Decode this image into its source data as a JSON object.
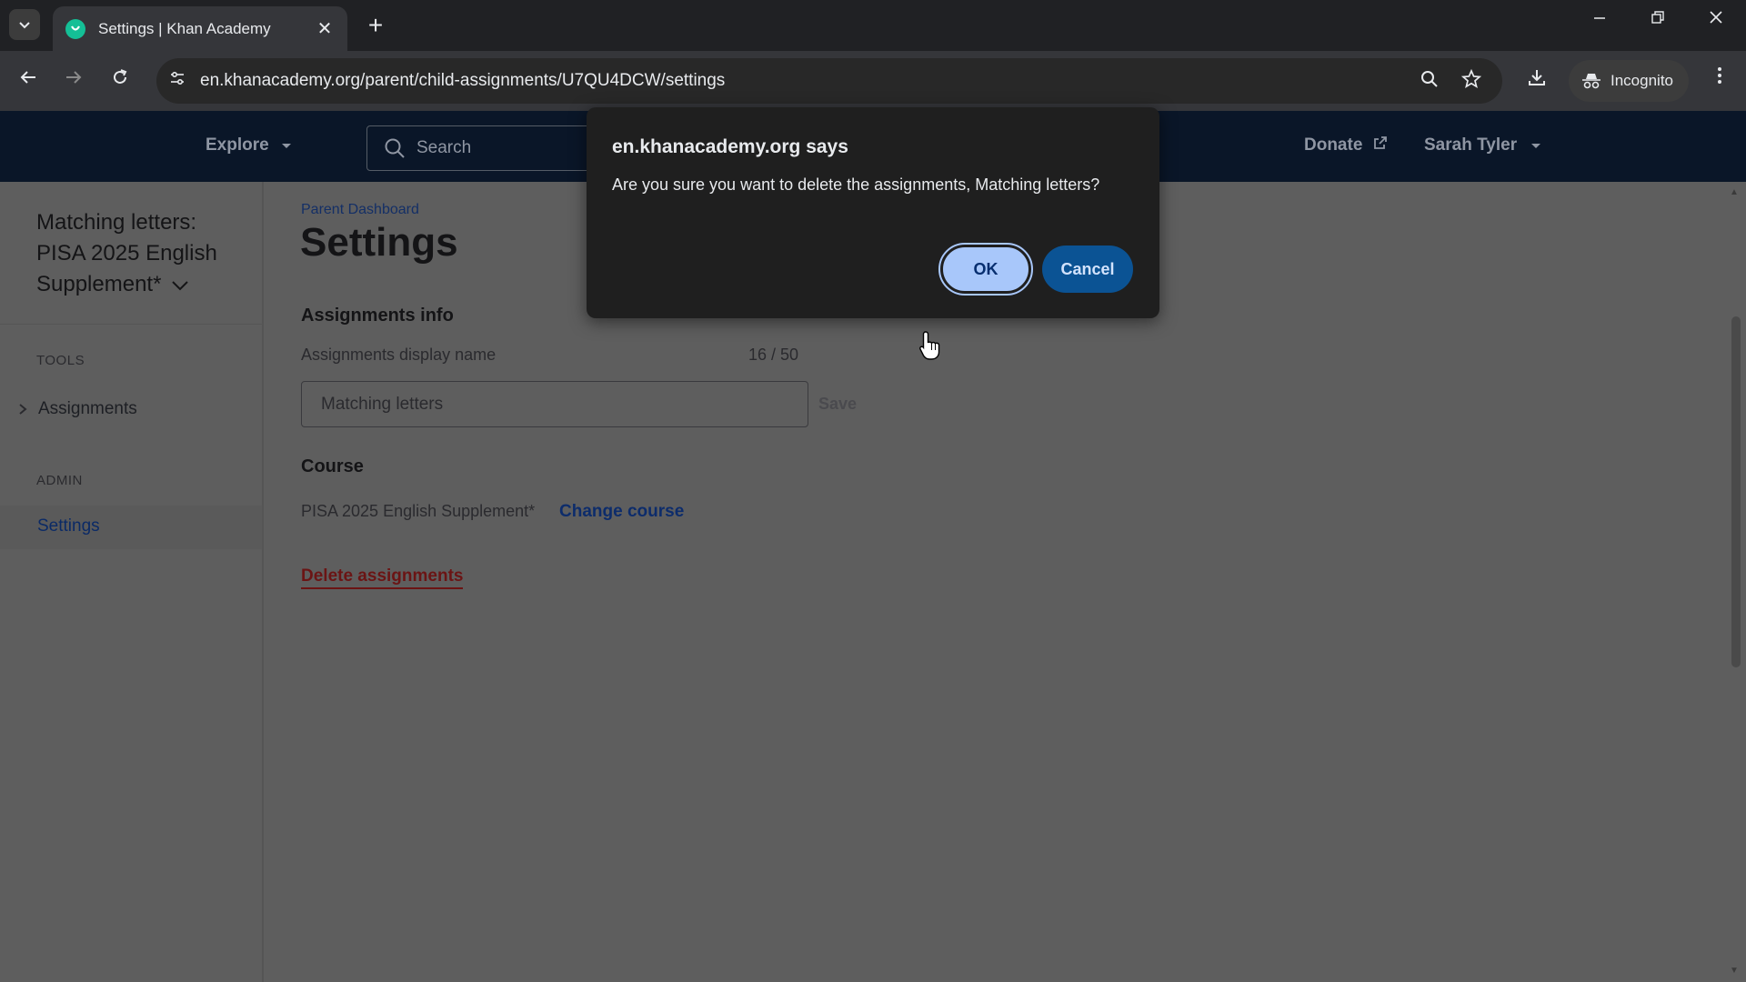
{
  "browser": {
    "tab_title": "Settings | Khan Academy",
    "tab_close": "✕",
    "new_tab": "+",
    "url": "en.khanacademy.org/parent/child-assignments/U7QU4DCW/settings",
    "incognito_label": "Incognito",
    "icons": {
      "tab_search": "chevron-down-icon",
      "favicon": "khan-academy-icon",
      "back": "back-arrow-icon",
      "forward": "forward-arrow-icon",
      "reload": "reload-icon",
      "site_info": "site-settings-icon",
      "zoom": "zoom-icon",
      "bookmark": "star-icon",
      "download": "download-icon",
      "incognito": "incognito-icon",
      "menu": "more-vert-icon"
    }
  },
  "header": {
    "explore_label": "Explore",
    "search_placeholder": "Search",
    "donate_label": "Donate",
    "user_name": "Sarah Tyler"
  },
  "sidebar": {
    "course_title": "Matching letters: PISA 2025 English Supplement*",
    "tools_heading": "TOOLS",
    "assignments_label": "Assignments",
    "admin_heading": "ADMIN",
    "settings_label": "Settings"
  },
  "main": {
    "breadcrumb": "Parent Dashboard",
    "title": "Settings",
    "assignments_info_heading": "Assignments info",
    "display_name_label": "Assignments display name",
    "char_count": "16 / 50",
    "display_name_value": "Matching letters",
    "save_label": "Save",
    "course_heading": "Course",
    "course_name": "PISA 2025 English Supplement*",
    "change_course_label": "Change course",
    "delete_label": "Delete assignments"
  },
  "dialog": {
    "title": "en.khanacademy.org says",
    "message": "Are you sure you want to delete the assignments, Matching letters?",
    "ok_label": "OK",
    "cancel_label": "Cancel"
  },
  "colors": {
    "page_overlay": "#5e5e5e",
    "header_bg": "#0a1628",
    "dialog_bg": "#1f1f1f",
    "ok_bg": "#a8c7fa",
    "cancel_bg": "#0b5394",
    "delete_red": "#6b1414",
    "link_blue": "#0d2c6b"
  }
}
